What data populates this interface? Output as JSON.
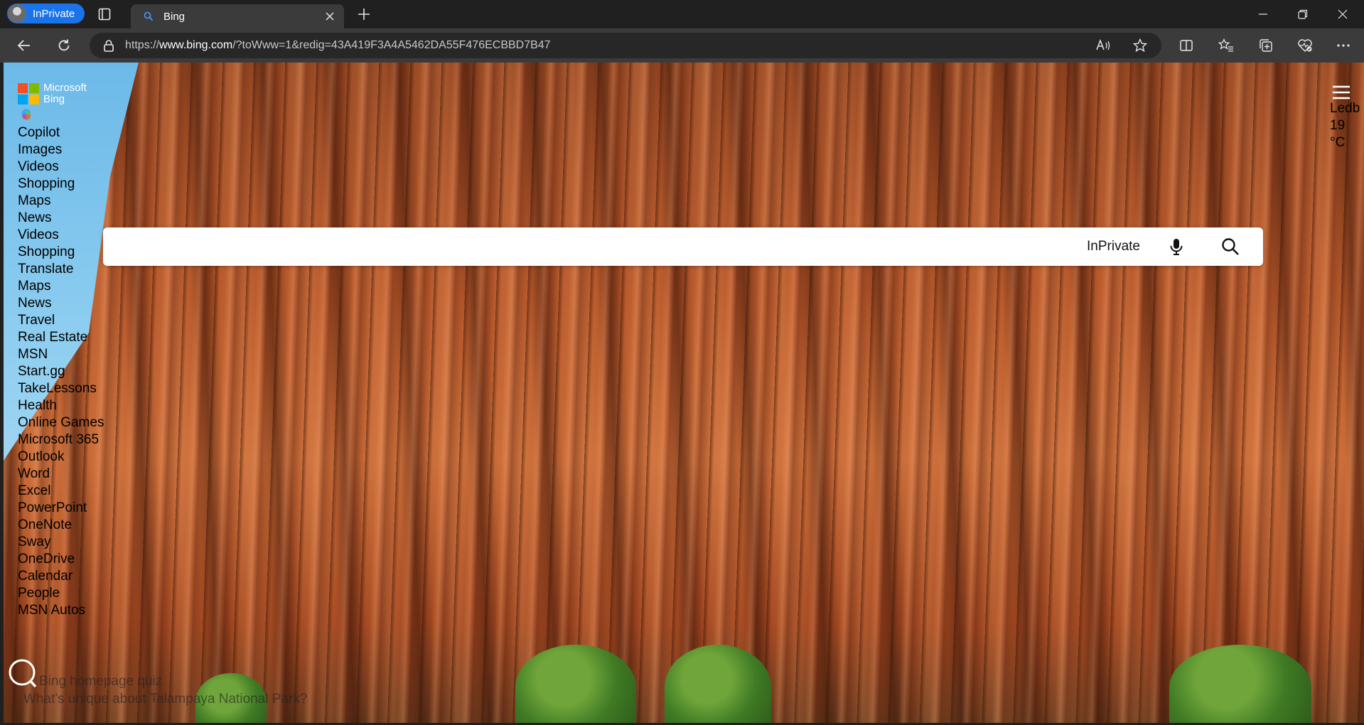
{
  "browser": {
    "inprivate_label": "InPrivate",
    "tab_title": "Bing",
    "url_prefix": "https://",
    "url_host": "www.bing.com",
    "url_path": "/?toWww=1&redig=43A419F3A4A5462DA55F476ECBBD7B47"
  },
  "brand": {
    "line1": "Microsoft",
    "line2": "Bing",
    "logo_colors": [
      "#f25022",
      "#7fba00",
      "#00a4ef",
      "#ffb900"
    ]
  },
  "nav": {
    "items": [
      "Copilot",
      "Images",
      "Videos",
      "Shopping",
      "Maps",
      "News",
      "Videos",
      "Shopping",
      "Translate",
      "Maps",
      "News",
      "Travel",
      "Real Estate",
      "MSN",
      "Start.gg",
      "TakeLessons",
      "Health",
      "Online Games",
      "Microsoft 365",
      "Outlook",
      "Word",
      "Excel",
      "PowerPoint",
      "OneNote",
      "Sway",
      "OneDrive",
      "Calendar",
      "People",
      "MSN Autos"
    ]
  },
  "weather": {
    "location": "Ledb",
    "temp": "19",
    "unit": "°C"
  },
  "search": {
    "value": "",
    "inprivate_label": "InPrivate"
  },
  "quiz": {
    "title": "Bing homepage quiz",
    "question": "What's unique about Talampaya National Park?"
  }
}
